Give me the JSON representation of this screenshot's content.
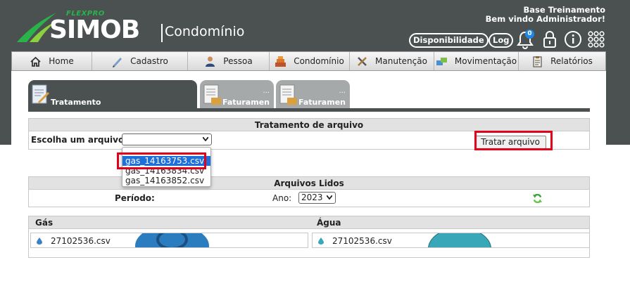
{
  "header": {
    "brand_prefix": "FLEXPRO",
    "brand_name": "SIMOB",
    "brand_product": "Condomínio",
    "welcome_line1": "Base Treinamento",
    "welcome_line2": "Bem vindo Administrador!",
    "availability_label": "Disponibilidade",
    "log_label": "Log",
    "notification_count": "0"
  },
  "menu": [
    {
      "label": "Home",
      "icon": "home-icon"
    },
    {
      "label": "Cadastro",
      "icon": "pen-icon"
    },
    {
      "label": "Pessoa",
      "icon": "person-icon"
    },
    {
      "label": "Condomínio",
      "icon": "building-icon"
    },
    {
      "label": "Manutenção",
      "icon": "tools-icon"
    },
    {
      "label": "Movimentação",
      "icon": "transfer-icon"
    },
    {
      "label": "Relatórios",
      "icon": "clipboard-icon"
    }
  ],
  "tabs": [
    {
      "label": "Tratamento",
      "active": true
    },
    {
      "label": "Faturamen",
      "dots": "...",
      "active": false
    },
    {
      "label": "Faturamen",
      "dots": "...",
      "active": false
    }
  ],
  "tratamento": {
    "title": "Tratamento de arquivo",
    "choose_label": "Escolha um arquivo:",
    "selected_value": "",
    "button_label": "Tratar arquivo",
    "options": [
      "gas_14163753.csv",
      "gas_14163834.csv",
      "gas_14163852.csv"
    ]
  },
  "lidos": {
    "title": "Arquivos Lidos",
    "period_label": "Período:",
    "year_label": "Ano:",
    "year_value": "2023"
  },
  "gas": {
    "title": "Gás",
    "file": "27102536.csv"
  },
  "agua": {
    "title": "Água",
    "file": "27102536.csv"
  },
  "colors": {
    "header_bg": "#4a5150",
    "accent_green": "#29b34a",
    "highlight_red": "#e3001b",
    "selection_blue": "#1e6fd9"
  }
}
